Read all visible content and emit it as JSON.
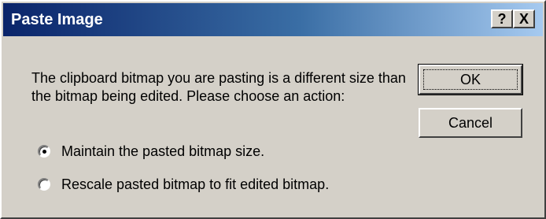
{
  "window": {
    "title": "Paste Image",
    "help_label": "?",
    "close_label": "X"
  },
  "message": "The clipboard bitmap you are pasting is a different size than the bitmap being edited. Please choose an action:",
  "buttons": {
    "ok": "OK",
    "cancel": "Cancel"
  },
  "options": [
    {
      "label": "Maintain the pasted bitmap size.",
      "selected": true
    },
    {
      "label": "Rescale pasted bitmap to fit edited bitmap.",
      "selected": false
    }
  ]
}
